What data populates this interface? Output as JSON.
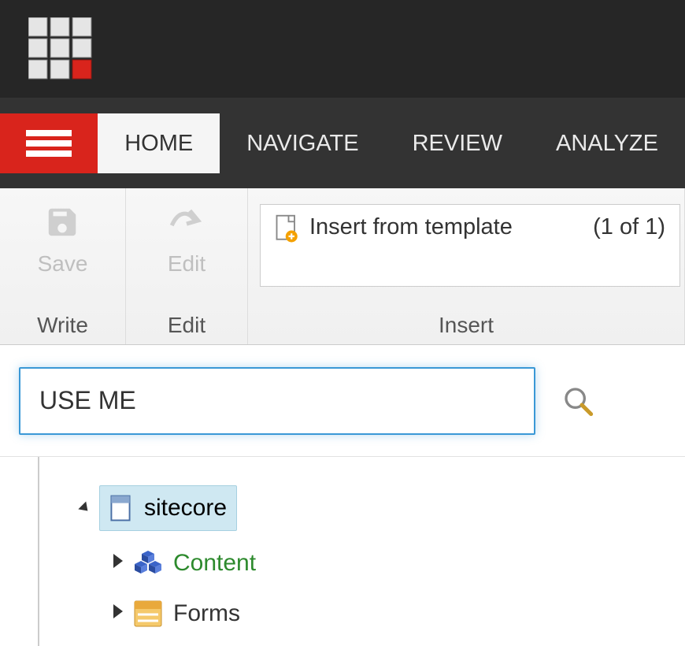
{
  "tabs": {
    "home": "HOME",
    "navigate": "NAVIGATE",
    "review": "REVIEW",
    "analyze": "ANALYZE"
  },
  "ribbon": {
    "save_label": "Save",
    "write_group": "Write",
    "edit_label": "Edit",
    "edit_group": "Edit",
    "insert_template_label": "Insert from template",
    "insert_count": "(1 of 1)",
    "insert_group": "Insert"
  },
  "search": {
    "value": "USE ME"
  },
  "tree": {
    "root": "sitecore",
    "content": "Content",
    "forms": "Forms"
  }
}
